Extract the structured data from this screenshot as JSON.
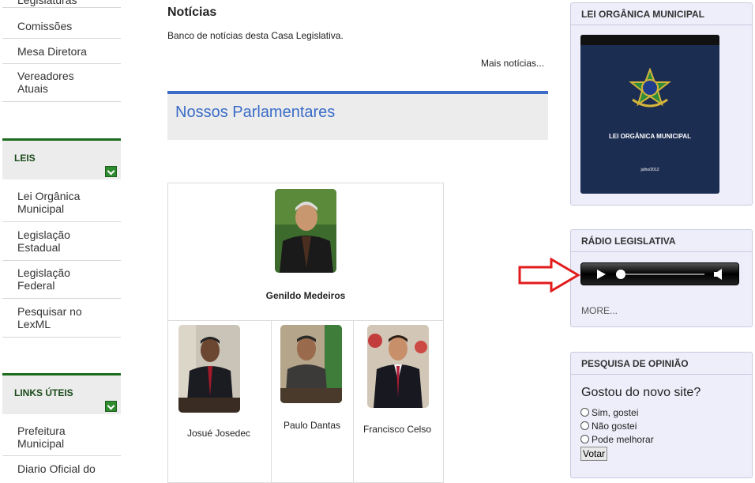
{
  "sidebar": {
    "top_items": [
      {
        "label": "Legislaturas"
      },
      {
        "label": "Comissões"
      },
      {
        "label": "Mesa Diretora"
      },
      {
        "label": "Vereadores Atuais"
      }
    ],
    "leis": {
      "title": "LEIS",
      "items": [
        {
          "label": "Lei Orgânica Municipal"
        },
        {
          "label": "Legislação Estadual"
        },
        {
          "label": "Legislação Federal"
        },
        {
          "label": "Pesquisar no LexML"
        }
      ]
    },
    "links": {
      "title": "LINKS ÚTEIS",
      "items": [
        {
          "label": "Prefeitura Municipal"
        },
        {
          "label": "Diario Oficial do"
        }
      ]
    }
  },
  "news": {
    "title": "Notícias",
    "description": "Banco de notícias desta Casa Legislativa.",
    "more": "Mais notícias..."
  },
  "parliament": {
    "title": "Nossos Parlamentares",
    "members": [
      {
        "name": "Genildo Medeiros"
      },
      {
        "name": "Josué Josedec"
      },
      {
        "name": "Paulo Dantas"
      },
      {
        "name": "Francisco Celso"
      }
    ]
  },
  "right": {
    "lei_organica": {
      "title": "LEI ORGÂNICA MUNICIPAL",
      "book_title": "LEI ORGÂNICA MUNICIPAL",
      "book_date": "julho/2012"
    },
    "radio": {
      "title": "RÁDIO LEGISLATIVA",
      "more": "MORE..."
    },
    "poll": {
      "title": "PESQUISA DE OPINIÃO",
      "question": "Gostou do novo site?",
      "options": [
        {
          "label": "Sim, gostei"
        },
        {
          "label": "Não gostei"
        },
        {
          "label": "Pode melhorar"
        }
      ],
      "vote_label": "Votar"
    }
  },
  "colors": {
    "accent_green": "#1d6b1d",
    "accent_blue": "#3a6cc8",
    "annotation_red": "#e21b1b"
  }
}
